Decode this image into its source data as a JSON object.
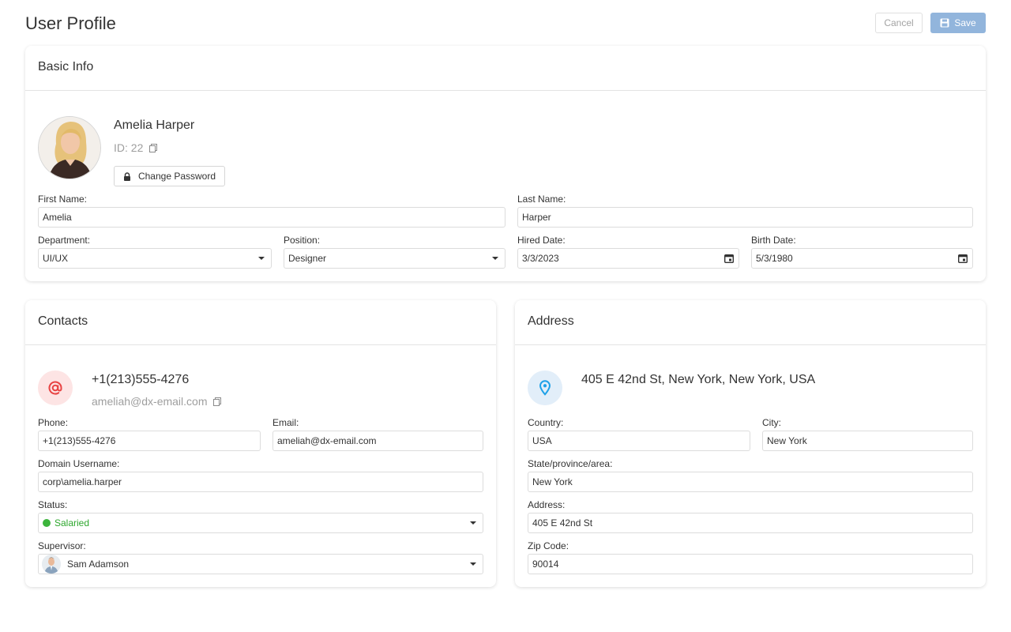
{
  "header": {
    "title": "User Profile",
    "cancel_label": "Cancel",
    "save_label": "Save"
  },
  "basic_info": {
    "title": "Basic Info",
    "name": "Amelia Harper",
    "id_text": "ID: 22",
    "change_password_label": "Change Password",
    "first_name": {
      "label": "First Name:",
      "value": "Amelia"
    },
    "last_name": {
      "label": "Last Name:",
      "value": "Harper"
    },
    "department": {
      "label": "Department:",
      "value": "UI/UX"
    },
    "position": {
      "label": "Position:",
      "value": "Designer"
    },
    "hired_date": {
      "label": "Hired Date:",
      "value": "3/3/2023"
    },
    "birth_date": {
      "label": "Birth Date:",
      "value": "5/3/1980"
    }
  },
  "contacts": {
    "title": "Contacts",
    "phone_display": "+1(213)555-4276",
    "email_display": "ameliah@dx-email.com",
    "phone": {
      "label": "Phone:",
      "value": "+1(213)555-4276"
    },
    "email": {
      "label": "Email:",
      "value": "ameliah@dx-email.com"
    },
    "domain_username": {
      "label": "Domain Username:",
      "value": "corp\\amelia.harper"
    },
    "status": {
      "label": "Status:",
      "value": "Salaried",
      "color": "#3cb43c"
    },
    "supervisor": {
      "label": "Supervisor:",
      "value": "Sam Adamson"
    }
  },
  "address": {
    "title": "Address",
    "full_address": "405 E 42nd St, New York, New York, USA",
    "country": {
      "label": "Country:",
      "value": "USA"
    },
    "city": {
      "label": "City:",
      "value": "New York"
    },
    "state": {
      "label": "State/province/area:",
      "value": "New York"
    },
    "street": {
      "label": "Address:",
      "value": "405 E 42nd St"
    },
    "zip": {
      "label": "Zip Code:",
      "value": "90014"
    }
  },
  "colors": {
    "accent_save": "#92b5dc",
    "contact_icon": "#e84343",
    "address_icon": "#1ea1e8",
    "status_green": "#3cb43c"
  },
  "icons": {
    "save": "floppy-disk-icon",
    "copy": "copy-icon",
    "lock": "lock-icon",
    "calendar": "calendar-icon",
    "at": "at-sign-icon",
    "location": "map-pin-icon",
    "dropdown": "caret-down-icon"
  }
}
